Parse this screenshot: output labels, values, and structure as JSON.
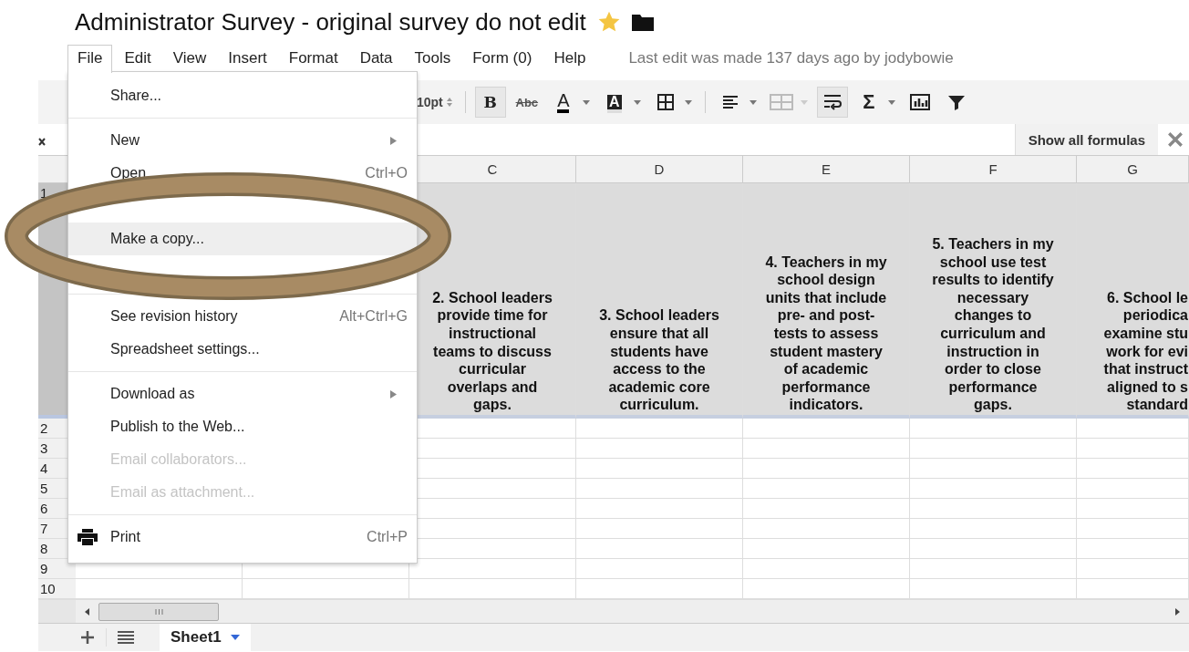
{
  "title": "Administrator Survey - original survey do not edit",
  "starred": true,
  "menubar": [
    {
      "label": "File",
      "selected": true
    },
    {
      "label": "Edit",
      "selected": false
    },
    {
      "label": "View",
      "selected": false
    },
    {
      "label": "Insert",
      "selected": false
    },
    {
      "label": "Format",
      "selected": false
    },
    {
      "label": "Data",
      "selected": false
    },
    {
      "label": "Tools",
      "selected": false
    },
    {
      "label": "Form (0)",
      "selected": false
    },
    {
      "label": "Help",
      "selected": false
    }
  ],
  "last_edit": "Last edit was made 137 days ago by jodybowie",
  "toolbar": [
    {
      "kind": "font-size",
      "label": "10pt"
    },
    {
      "kind": "separator"
    },
    {
      "kind": "bold",
      "label": "B",
      "selected": true
    },
    {
      "kind": "strike",
      "label": "Abc"
    },
    {
      "kind": "text-color",
      "label": "A",
      "dropdown": true
    },
    {
      "kind": "highlight",
      "label": "A",
      "dropdown": true
    },
    {
      "kind": "borders",
      "dropdown": true
    },
    {
      "kind": "separator"
    },
    {
      "kind": "align",
      "dropdown": true
    },
    {
      "kind": "merge",
      "dropdown": true,
      "disabled": true
    },
    {
      "kind": "wrap",
      "selected": true
    },
    {
      "kind": "sum",
      "label": "Σ",
      "dropdown": true
    },
    {
      "kind": "chart"
    },
    {
      "kind": "filter"
    }
  ],
  "formula_bar": {
    "button": "Show all formulas"
  },
  "table": {
    "columns": [
      "C",
      "D",
      "E",
      "F",
      "G"
    ],
    "rows": [
      {
        "number": "1",
        "frozen": true,
        "cells": [
          "2. School leaders\nprovide time for\ninstructional\nteams to discuss\ncurricular\noverlaps and\ngaps.",
          "3. School leaders\nensure that all\nstudents have\naccess to the\nacademic core\ncurriculum.",
          "4. Teachers in my\nschool design\nunits that include\npre- and post-\ntests to assess\nstudent mastery\nof academic\nperformance\nindicators.",
          "5. Teachers in my\nschool use test\nresults to identify\nnecessary\nchanges to\ncurriculum and\ninstruction in\norder to close\nperformance\ngaps.",
          "6. School le\nperiodica\nexamine stu\nwork for evi\nthat instruct\naligned to s\nstandard"
        ]
      },
      {
        "number": "2",
        "frozen": false
      },
      {
        "number": "3",
        "frozen": false
      },
      {
        "number": "4",
        "frozen": false
      },
      {
        "number": "5",
        "frozen": false
      },
      {
        "number": "6",
        "frozen": false
      },
      {
        "number": "7",
        "frozen": false
      },
      {
        "number": "8",
        "frozen": false
      },
      {
        "number": "9",
        "frozen": false
      },
      {
        "number": "10",
        "frozen": false
      }
    ]
  },
  "file_menu": [
    {
      "kind": "item",
      "label": "Share...",
      "selected": false,
      "disabled": false
    },
    {
      "kind": "separator"
    },
    {
      "kind": "item",
      "label": "New",
      "submenu": true,
      "selected": false,
      "disabled": false
    },
    {
      "kind": "item",
      "label": "Open",
      "shortcut": "Ctrl+O",
      "selected": false,
      "disabled": false
    },
    {
      "kind": "covered"
    },
    {
      "kind": "item",
      "label": "Make a copy...",
      "selected": true,
      "disabled": false
    },
    {
      "kind": "covered"
    },
    {
      "kind": "separator"
    },
    {
      "kind": "item",
      "label": "See revision history",
      "shortcut": "Alt+Ctrl+G",
      "selected": false,
      "disabled": false
    },
    {
      "kind": "item",
      "label": "Spreadsheet settings...",
      "selected": false,
      "disabled": false
    },
    {
      "kind": "separator"
    },
    {
      "kind": "item",
      "label": "Download as",
      "submenu": true,
      "selected": false,
      "disabled": false
    },
    {
      "kind": "item",
      "label": "Publish to the Web...",
      "selected": false,
      "disabled": false
    },
    {
      "kind": "item",
      "label": "Email collaborators...",
      "selected": false,
      "disabled": true
    },
    {
      "kind": "item",
      "label": "Email as attachment...",
      "selected": false,
      "disabled": true
    },
    {
      "kind": "separator"
    },
    {
      "kind": "print",
      "label": "Print",
      "shortcut": "Ctrl+P",
      "selected": false,
      "disabled": false
    }
  ],
  "sheet_tabs": [
    {
      "label": "Sheet1",
      "selected": true
    }
  ]
}
